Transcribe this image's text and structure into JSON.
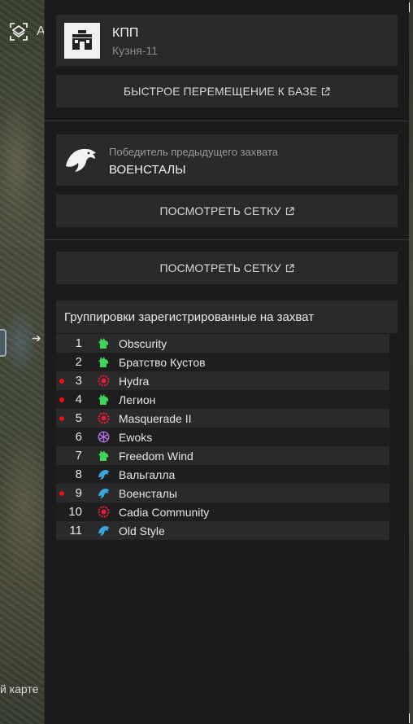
{
  "map": {
    "top_label": "А",
    "bottom_label": "й карте"
  },
  "panel": {
    "kpp": {
      "title": "КПП",
      "subtitle": "Кузня-11"
    },
    "fast_travel_label": "БЫСТРОЕ ПЕРЕМЕЩЕНИЕ К БАЗЕ",
    "winner": {
      "label": "Победитель предыдущего захвата",
      "name": "ВОЕНСТАЛЫ"
    },
    "view_grid_label_1": "ПОСМОТРЕТЬ СЕТКУ",
    "view_grid_label_2": "ПОСМОТРЕТЬ СЕТКУ",
    "groups_title": "Группировки зарегистрированные на захват",
    "groups": [
      {
        "num": "1",
        "name": "Obscurity",
        "icon": "green-wolf-icon",
        "marked": false
      },
      {
        "num": "2",
        "name": "Братство Кустов",
        "icon": "green-wolf-icon",
        "marked": false
      },
      {
        "num": "3",
        "name": "Hydra",
        "icon": "red-gear-icon",
        "marked": true
      },
      {
        "num": "4",
        "name": "Легион",
        "icon": "green-wolf-icon",
        "marked": true
      },
      {
        "num": "5",
        "name": "Masquerade II",
        "icon": "red-gear-icon",
        "marked": true
      },
      {
        "num": "6",
        "name": "Ewoks",
        "icon": "purple-snowflake-icon",
        "marked": false
      },
      {
        "num": "7",
        "name": "Freedom Wind",
        "icon": "green-wolf-icon",
        "marked": false
      },
      {
        "num": "8",
        "name": "Вальгалла",
        "icon": "blue-eagle-icon",
        "marked": false
      },
      {
        "num": "9",
        "name": "Военсталы",
        "icon": "blue-eagle-icon",
        "marked": true
      },
      {
        "num": "10",
        "name": "Cadia Community",
        "icon": "red-gear-icon",
        "marked": false
      },
      {
        "num": "11",
        "name": "Old Style",
        "icon": "blue-eagle-icon",
        "marked": false
      }
    ]
  },
  "colors": {
    "panel_bg": "#1b1b1b",
    "card_bg": "#2a2a2a",
    "marker_red": "#ee1111",
    "wolf_green": "#3fd45a",
    "gear_red": "#e0203a",
    "snowflake_purple": "#b070e0",
    "eagle_blue": "#3aa6e0"
  }
}
